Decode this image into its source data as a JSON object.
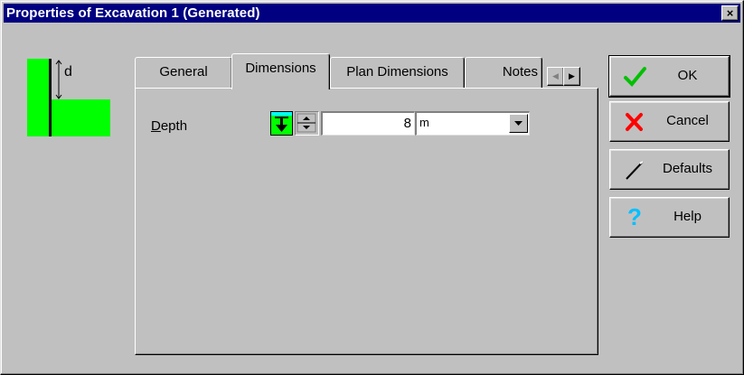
{
  "window": {
    "title": "Properties of Excavation 1 (Generated)",
    "close_label": "×"
  },
  "preview": {
    "dimension_label": "d",
    "accent_color": "#00ff00"
  },
  "tabs": [
    {
      "label": "General",
      "active": false
    },
    {
      "label": "Dimensions",
      "active": true
    },
    {
      "label": "Plan Dimensions",
      "active": false
    },
    {
      "label": "Notes",
      "active": false
    }
  ],
  "tab_scroll": {
    "left_icon": "triangle-left-icon",
    "right_icon": "triangle-right-icon"
  },
  "depth": {
    "label_mnemonic": "D",
    "label_rest": "epth",
    "value": "8",
    "unit": "m"
  },
  "buttons": {
    "ok": "OK",
    "cancel": "Cancel",
    "defaults": "Defaults",
    "help": "Help"
  },
  "colors": {
    "titlebar": "#000080",
    "face": "#c0c0c0",
    "ok_check": "#00c000",
    "cancel_x": "#ff0000",
    "help_q": "#00c0ff"
  }
}
